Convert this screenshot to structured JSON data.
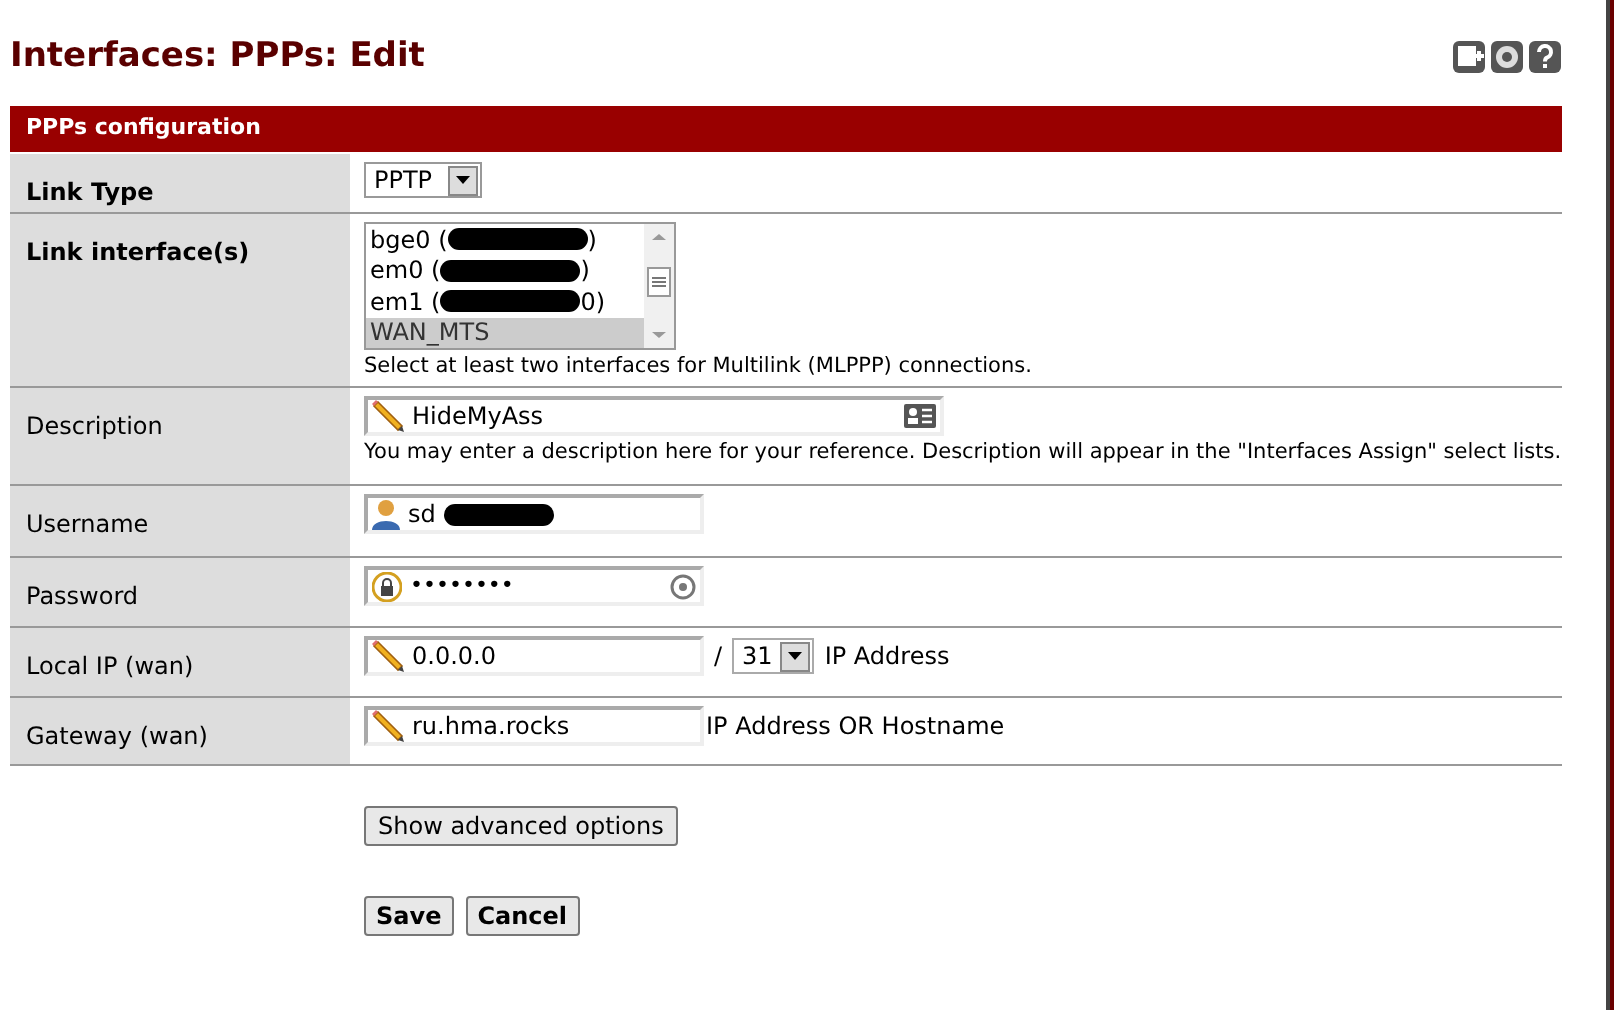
{
  "title": "Interfaces: PPPs: Edit",
  "section_title": "PPPs configuration",
  "link_type": {
    "label": "Link Type",
    "value": "PPTP"
  },
  "link_interfaces": {
    "label": "Link interface(s)",
    "options": [
      {
        "text": "bge0 (",
        "tail": ")",
        "redacted": true,
        "selected": false
      },
      {
        "text": "em0 (",
        "tail": ")",
        "redacted": true,
        "selected": false
      },
      {
        "text": "em1 (",
        "tail": "0)",
        "redacted": true,
        "selected": false
      },
      {
        "text": "WAN_MTS",
        "redacted": false,
        "selected": true
      }
    ],
    "hint": "Select at least two interfaces for Multilink (MLPPP) connections."
  },
  "description": {
    "label": "Description",
    "value": "HideMyAss",
    "hint": "You may enter a description here for your reference. Description will appear in the \"Interfaces Assign\" select lists."
  },
  "username": {
    "label": "Username",
    "value": "sd",
    "redacted": true
  },
  "password": {
    "label": "Password",
    "value": "••••••••"
  },
  "local_ip": {
    "label": "Local IP (wan)",
    "value": "0.0.0.0",
    "separator": "/",
    "subnet": "31",
    "note": "IP Address"
  },
  "gateway": {
    "label": "Gateway (wan)",
    "value": "ru.hma.rocks",
    "note": "IP Address OR Hostname"
  },
  "buttons": [
    {
      "label": "Show advanced options",
      "kind": "plain"
    },
    {
      "label": "Save",
      "kind": "bold"
    },
    {
      "label": "Cancel",
      "kind": "bold"
    }
  ]
}
